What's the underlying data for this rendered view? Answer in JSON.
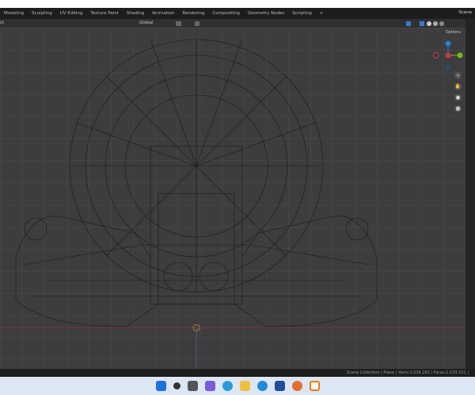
{
  "topbar": {
    "tabs": [
      "Modeling",
      "Sculpting",
      "UV Editing",
      "Texture Paint",
      "Shading",
      "Animation",
      "Rendering",
      "Compositing",
      "Geometry Nodes",
      "Scripting",
      "+"
    ],
    "scene": "Scene"
  },
  "header": {
    "left": "ct",
    "orientation": "Global",
    "options": "Options"
  },
  "status": {
    "text": "Scene Collection | Plane | Verts:1,034,282 | Faces:1,033,331 |"
  },
  "colors": {
    "x_axis": "#c33b4c",
    "y_axis": "#7db522",
    "z_axis": "#2a7fd6",
    "origin": "#f0a030"
  }
}
